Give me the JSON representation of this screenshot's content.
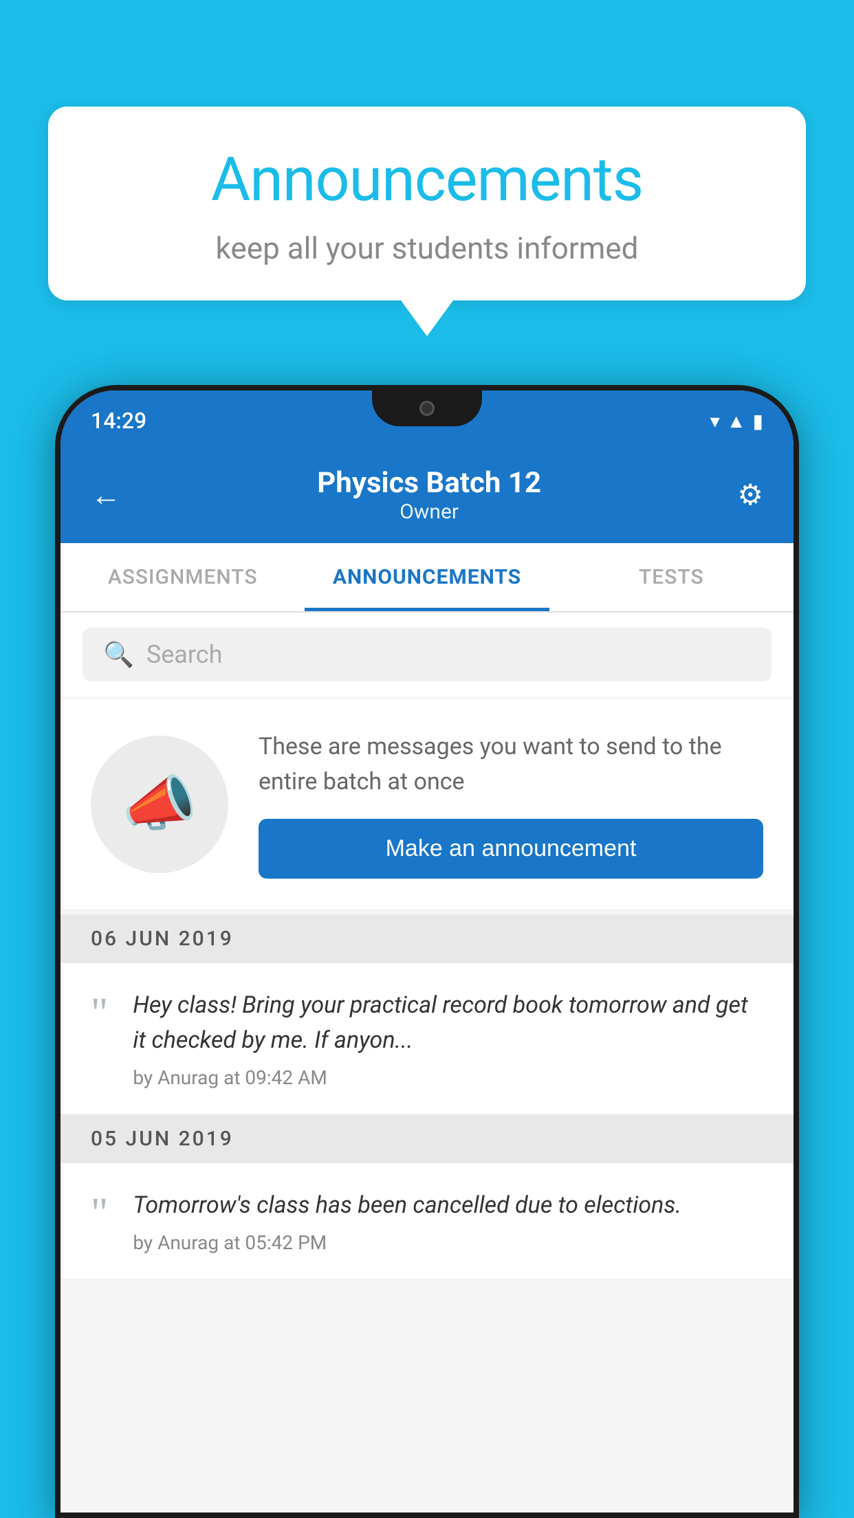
{
  "background_color": "#1bbce8",
  "speech_bubble": {
    "title": "Announcements",
    "subtitle": "keep all your students informed"
  },
  "phone": {
    "status_bar": {
      "time": "14:29"
    },
    "header": {
      "back_label": "←",
      "batch_name": "Physics Batch 12",
      "batch_role": "Owner",
      "settings_label": "⚙"
    },
    "tabs": [
      {
        "label": "ASSIGNMENTS",
        "active": false
      },
      {
        "label": "ANNOUNCEMENTS",
        "active": true
      },
      {
        "label": "TESTS",
        "active": false
      }
    ],
    "search": {
      "placeholder": "Search"
    },
    "announce_section": {
      "description": "These are messages you want to send to the entire batch at once",
      "button_label": "Make an announcement"
    },
    "announcements": [
      {
        "date": "06  JUN  2019",
        "text": "Hey class! Bring your practical record book tomorrow and get it checked by me. If anyon...",
        "meta": "by Anurag at 09:42 AM"
      },
      {
        "date": "05  JUN  2019",
        "text": "Tomorrow's class has been cancelled due to elections.",
        "meta": "by Anurag at 05:42 PM"
      }
    ]
  }
}
